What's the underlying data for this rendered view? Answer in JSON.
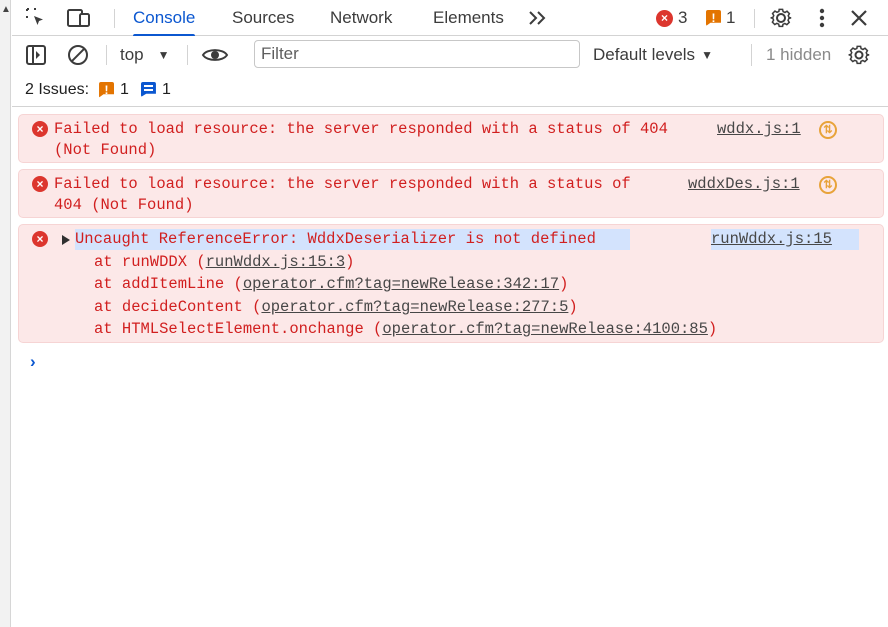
{
  "tabs": {
    "console": "Console",
    "sources": "Sources",
    "network": "Network",
    "elements": "Elements"
  },
  "counts": {
    "errors": "3",
    "warnings": "1",
    "error_mark": "×",
    "warning_mark": "!"
  },
  "toolbar": {
    "context": "top",
    "filter_placeholder": "Filter",
    "levels": "Default levels",
    "hidden": "1 hidden"
  },
  "issues": {
    "label": "2 Issues:",
    "warnings": "1",
    "messages": "1",
    "warning_mark": "!"
  },
  "messages": [
    {
      "text": "Failed to load resource: the server responded with a status of 404\n(Not Found)",
      "source": "wddx.js:1",
      "error_mark": "×"
    },
    {
      "text": "Failed to load resource: the server responded with a status of\n404 (Not Found)",
      "source": "wddxDes.js:1",
      "error_mark": "×"
    },
    {
      "headline": "Uncaught ReferenceError: WddxDeserializer is not defined",
      "source": "runWddx.js:15",
      "error_mark": "×",
      "stack": [
        {
          "prefix": "at runWDDX (",
          "link": "runWddx.js:15:3",
          "suffix": ")"
        },
        {
          "prefix": "at addItemLine (",
          "link": "operator.cfm?tag=newRelease:342:17",
          "suffix": ")"
        },
        {
          "prefix": "at decideContent (",
          "link": "operator.cfm?tag=newRelease:277:5",
          "suffix": ")"
        },
        {
          "prefix": "at HTMLSelectElement.onchange (",
          "link": "operator.cfm?tag=newRelease:4100:85",
          "suffix": ")"
        }
      ]
    }
  ],
  "prompt": "›",
  "colors": {
    "accent": "#0b57d0",
    "error": "#d11f1f",
    "error_bg": "#fce8e8",
    "warning": "#e37400"
  },
  "icons": [
    "inspect-element-icon",
    "device-toolbar-icon",
    "more-tabs-icon",
    "settings-gear-icon",
    "kebab-menu-icon",
    "close-icon",
    "sidebar-toggle-icon",
    "clear-console-icon",
    "eye-icon",
    "network-request-icon",
    "expand-triangle-icon"
  ]
}
